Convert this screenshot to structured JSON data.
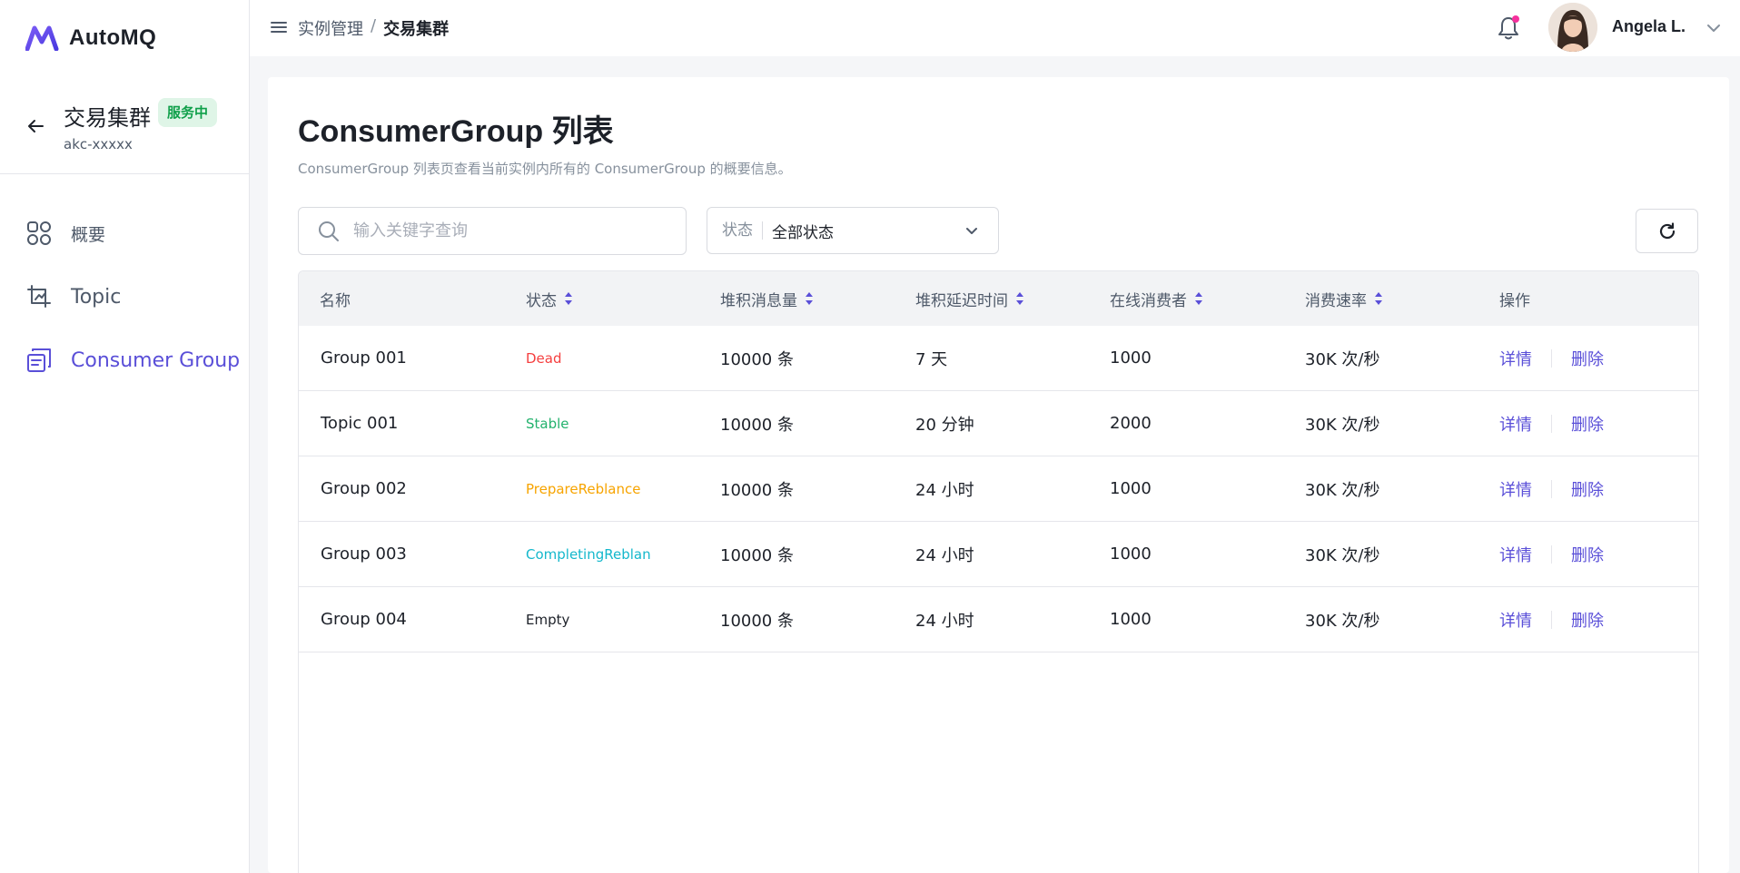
{
  "app": {
    "logo_text": "AutoMQ"
  },
  "cluster": {
    "name": "交易集群",
    "badge": "服务中",
    "id": "akc-xxxxx"
  },
  "sidebar": {
    "items": [
      {
        "label": "概要",
        "icon": "overview-grid-icon",
        "active": false
      },
      {
        "label": "Topic",
        "icon": "topic-crop-icon",
        "active": false
      },
      {
        "label": "Consumer Group",
        "icon": "consumer-group-icon",
        "active": true
      }
    ]
  },
  "header": {
    "breadcrumb_parent": "实例管理",
    "breadcrumb_sep": "/",
    "breadcrumb_current": "交易集群",
    "user_name": "Angela L."
  },
  "main": {
    "title": "ConsumerGroup 列表",
    "description": "ConsumerGroup 列表页查看当前实例内所有的 ConsumerGroup 的概要信息。",
    "search_placeholder": "输入关键字查询",
    "filter_label": "状态",
    "filter_value": "全部状态"
  },
  "table": {
    "columns": [
      "名称",
      "状态",
      "堆积消息量",
      "堆积延迟时间",
      "在线消费者",
      "消费速率",
      "操作"
    ],
    "rows": [
      {
        "name": "Group 001",
        "status": "Dead",
        "status_color": "#f53f3f",
        "backlog": "10000 条",
        "delay": "7 天",
        "consumers": "1000",
        "rate": "30K 次/秒"
      },
      {
        "name": "Topic 001",
        "status": "Stable",
        "status_color": "#23b26d",
        "backlog": "10000 条",
        "delay": "20 分钟",
        "consumers": "2000",
        "rate": "30K 次/秒"
      },
      {
        "name": "Group 002",
        "status": "PrepareReblance",
        "status_color": "#f7a400",
        "backlog": "10000 条",
        "delay": "24 小时",
        "consumers": "1000",
        "rate": "30K 次/秒"
      },
      {
        "name": "Group 003",
        "status": "CompletingReblan",
        "status_color": "#14b8cc",
        "backlog": "10000 条",
        "delay": "24 小时",
        "consumers": "1000",
        "rate": "30K 次/秒"
      },
      {
        "name": "Group 004",
        "status": "Empty",
        "status_color": "#1d2129",
        "backlog": "10000 条",
        "delay": "24 小时",
        "consumers": "1000",
        "rate": "30K 次/秒"
      }
    ],
    "action_detail": "详情",
    "action_delete": "删除"
  },
  "colors": {
    "accent": "#5a4fd8",
    "badge_bg": "#dff5e7",
    "badge_text": "#10a04a"
  }
}
